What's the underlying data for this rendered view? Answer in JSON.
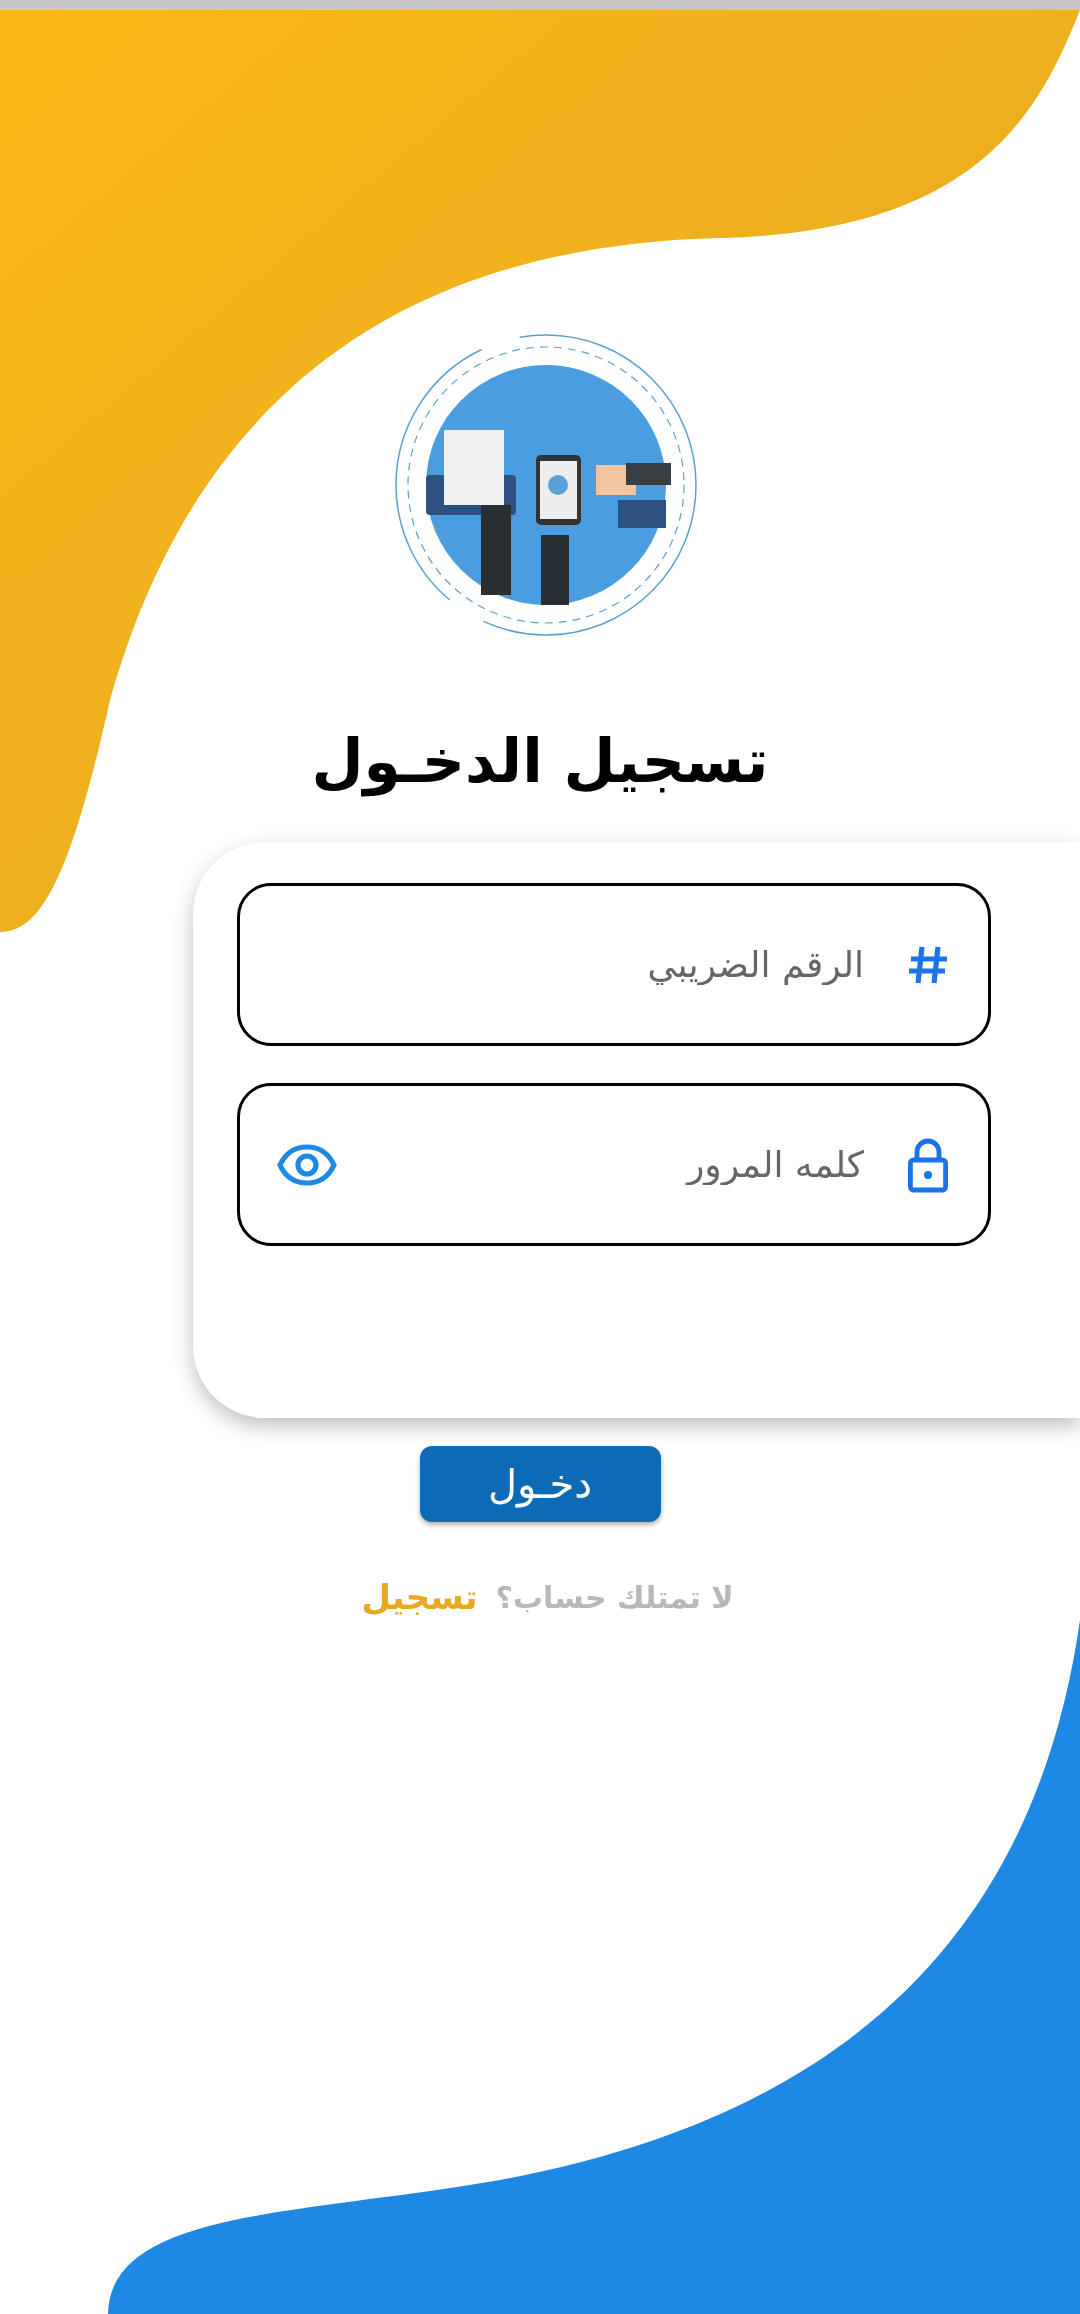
{
  "title": "تسجيل الدخـول",
  "fields": [
    {
      "kind": "tax_number",
      "placeholder": "الرقم الضريبي"
    },
    {
      "kind": "password",
      "placeholder": "كلمه المرور"
    }
  ],
  "login_button": "دخـول",
  "signup": {
    "prompt": "لا تمتلك حساب؟",
    "link": "تسجيل"
  }
}
